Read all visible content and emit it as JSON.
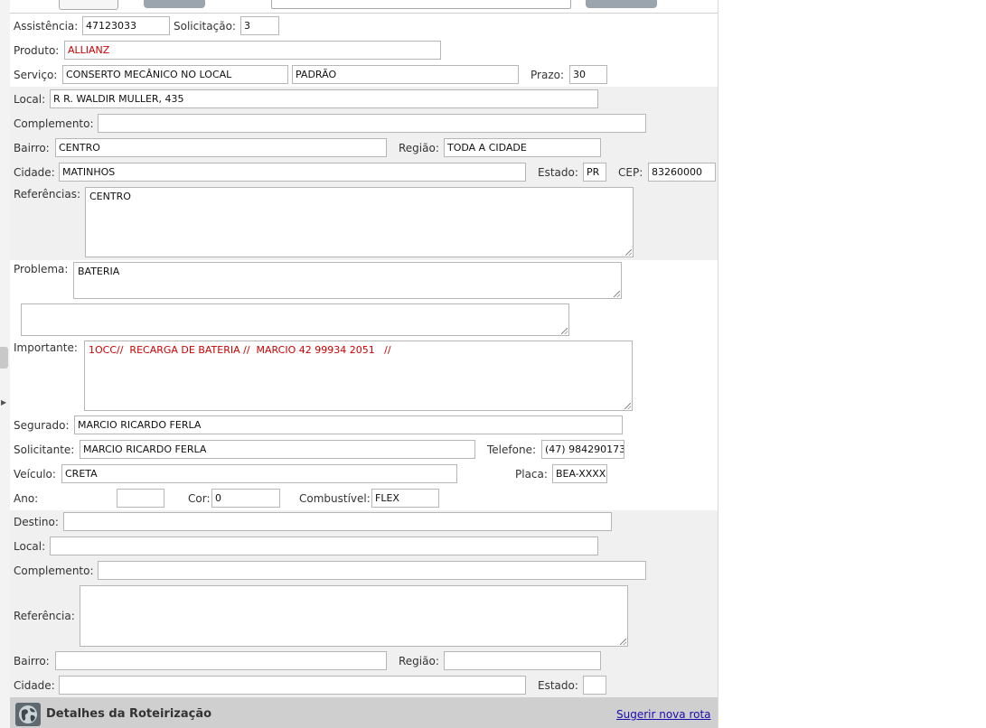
{
  "form": {
    "assistencia": {
      "label": "Assistência:",
      "value": "47123033"
    },
    "solicitacao": {
      "label": "Solicitação:",
      "value": "3"
    },
    "produto": {
      "label": "Produto:",
      "value": "ALLIANZ"
    },
    "servico": {
      "label": "Serviço:",
      "value": "CONSERTO MECÂNICO NO LOCAL",
      "tipo": "PADRÃO"
    },
    "prazo": {
      "label": "Prazo:",
      "value": "30"
    },
    "local": {
      "label": "Local:",
      "value": "R R. WALDIR MULLER, 435"
    },
    "complemento": {
      "label": "Complemento:",
      "value": ""
    },
    "bairro": {
      "label": "Bairro:",
      "value": "CENTRO"
    },
    "regiao": {
      "label": "Região:",
      "value": "TODA A CIDADE"
    },
    "cidade": {
      "label": "Cidade:",
      "value": "MATINHOS"
    },
    "estado": {
      "label": "Estado:",
      "value": "PR"
    },
    "cep": {
      "label": "CEP:",
      "value": "83260000"
    },
    "referencias": {
      "label": "Referências:",
      "value": "CENTRO"
    },
    "problema": {
      "label": "Problema:",
      "value": "BATERIA",
      "extra": ""
    },
    "importante": {
      "label": "Importante:",
      "value": "1OCC//  RECARGA DE BATERIA //  MARCIO 42 99934 2051   //"
    },
    "segurado": {
      "label": "Segurado:",
      "value": "MARCIO RICARDO FERLA"
    },
    "solicitante": {
      "label": "Solicitante:",
      "value": "MARCIO RICARDO FERLA"
    },
    "telefone": {
      "label": "Telefone:",
      "value": "(47) 984290173"
    },
    "veiculo": {
      "label": "Veículo:",
      "value": "CRETA"
    },
    "placa": {
      "label": "Placa:",
      "value": "BEA-XXXX"
    },
    "ano": {
      "label": "Ano:",
      "value": ""
    },
    "cor": {
      "label": "Cor:",
      "value": "0"
    },
    "combustivel": {
      "label": "Combustível:",
      "value": "FLEX"
    }
  },
  "destino": {
    "destino": {
      "label": "Destino:",
      "value": ""
    },
    "local": {
      "label": "Local:",
      "value": ""
    },
    "complemento": {
      "label": "Complemento:",
      "value": ""
    },
    "referencia": {
      "label": "Referência:",
      "value": ""
    },
    "bairro": {
      "label": "Bairro:",
      "value": ""
    },
    "regiao": {
      "label": "Região:",
      "value": ""
    },
    "cidade": {
      "label": "Cidade:",
      "value": ""
    },
    "estado": {
      "label": "Estado:",
      "value": ""
    }
  },
  "footer": {
    "title": "Detalhes da Roteirização",
    "link": "Sugerir nova rota",
    "icon": "globe-icon"
  },
  "colors": {
    "highlight_text": "#cc0000",
    "band": "#f0f0f0",
    "footer": "#cfcfcf",
    "link": "#1a0dab"
  }
}
